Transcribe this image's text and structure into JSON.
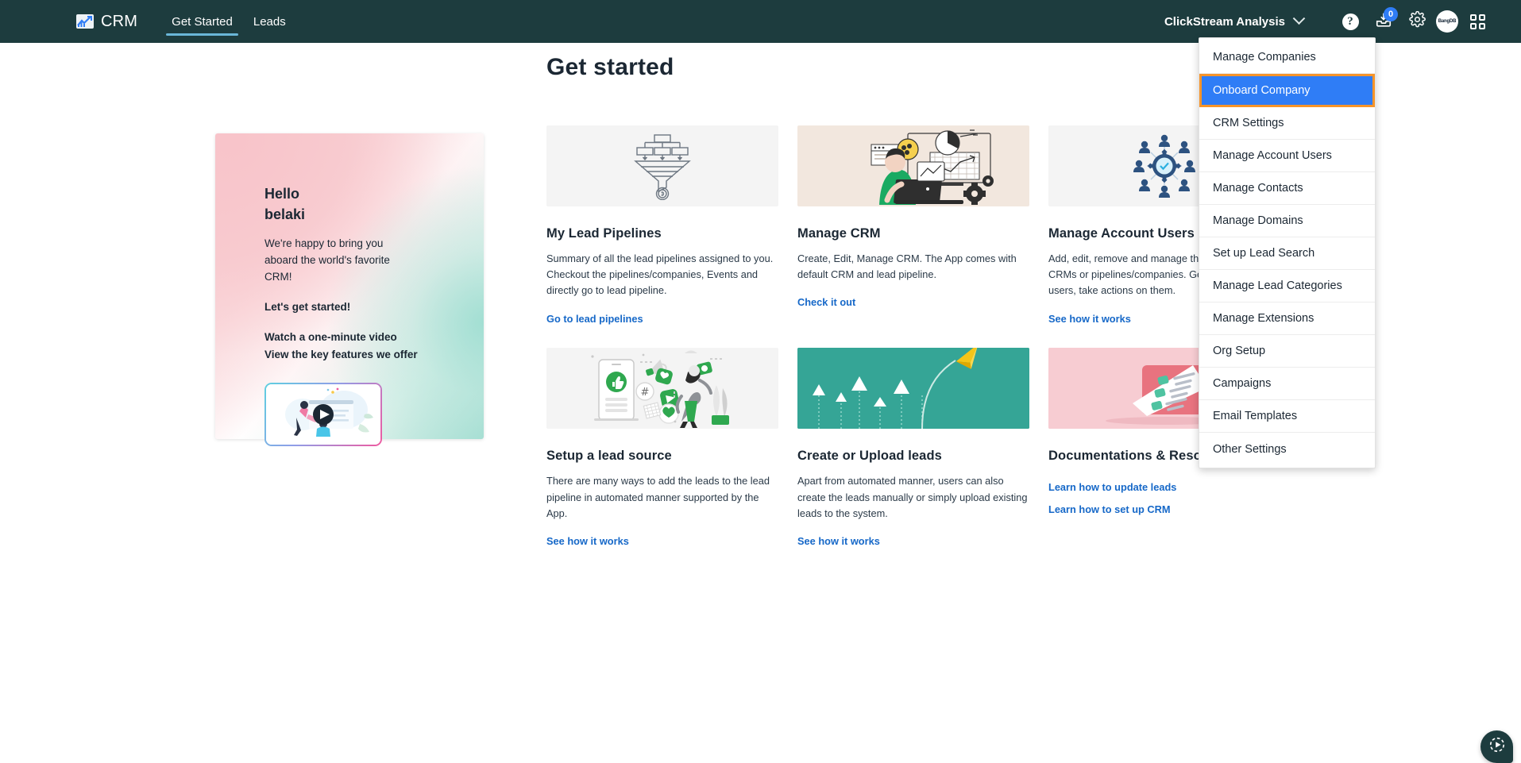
{
  "header": {
    "brand": "CRM",
    "brand_logo_icon": "chart-arrow-logo",
    "nav": [
      {
        "label": "Get Started",
        "active": true
      },
      {
        "label": "Leads",
        "active": false
      }
    ],
    "account_selector": {
      "label": "ClickStream Analysis",
      "chevron_icon": "chevron-down-icon"
    },
    "help_icon": "question-mark-icon",
    "help_glyph": "?",
    "inbox_icon": "inbox-download-icon",
    "inbox_badge": "0",
    "settings_icon": "gear-icon",
    "avatar_icon": "user-avatar",
    "avatar_text": "BangDB",
    "apps_icon": "grid-apps-icon",
    "bg_color": "#1d3c3e",
    "active_underline_color": "#6ab6d8",
    "badge_color": "#2f7df6"
  },
  "page": {
    "title": "Get started"
  },
  "hello_card": {
    "greeting_line1": "Hello",
    "greeting_line2": "belaki",
    "body": "We're happy to bring you aboard the world's favorite CRM!",
    "cta": "Let's get started!",
    "links": [
      "Watch a one-minute video",
      "View the key features we offer"
    ],
    "video_icon": "play-button-icon",
    "video_alt": "one-minute intro video thumbnail"
  },
  "cards": [
    {
      "title": "My Lead Pipelines",
      "desc": "Summary of all the lead pipelines assigned to you. Checkout the pipelines/companies, Events and directly go to lead pipeline.",
      "links": [
        "Go to lead pipelines"
      ],
      "image_icon": "funnel-pipeline-illustration",
      "image_bg": "#f4f4f4"
    },
    {
      "title": "Manage CRM",
      "desc": "Create, Edit, Manage CRM. The App comes with default CRM and lead pipeline.",
      "links": [
        "Check it out"
      ],
      "image_icon": "person-at-desk-analytics-illustration",
      "image_bg": "#f2e7de"
    },
    {
      "title": "Manage Account Users",
      "desc": "Add, edit, remove and manage the users for the CRMs or pipelines/companies. Get the list of all users, take actions on them.",
      "links": [
        "See how it works"
      ],
      "image_icon": "users-network-gear-illustration",
      "image_bg": "#f4f4f4"
    },
    {
      "title": "Setup a lead source",
      "desc": "There are many ways to add the leads to the lead pipeline in automated manner supported by the App.",
      "links": [
        "See how it works"
      ],
      "image_icon": "social-media-marketing-illustration",
      "image_bg": "#f4f4f4"
    },
    {
      "title": "Create or Upload leads",
      "desc": "Apart from automated manner, users can also create the leads manually or simply upload existing leads to the system.",
      "links": [
        "See how it works"
      ],
      "image_icon": "paper-plane-growth-arrows-illustration",
      "image_bg": "#35a596"
    },
    {
      "title": "Documentations & Resources",
      "desc": "",
      "links": [
        "Learn how to update leads",
        "Learn how to set up CRM"
      ],
      "image_icon": "checklist-pencil-illustration",
      "image_bg": "#f7ccd2"
    }
  ],
  "dropdown": {
    "items": [
      {
        "label": "Manage Companies",
        "selected": false
      },
      {
        "label": "Onboard Company",
        "selected": true
      },
      {
        "label": "CRM Settings",
        "selected": false
      },
      {
        "label": "Manage Account Users",
        "selected": false
      },
      {
        "label": "Manage Contacts",
        "selected": false
      },
      {
        "label": "Manage Domains",
        "selected": false
      },
      {
        "label": "Set up Lead Search",
        "selected": false
      },
      {
        "label": "Manage Lead Categories",
        "selected": false
      },
      {
        "label": "Manage Extensions",
        "selected": false
      },
      {
        "label": "Org Setup",
        "selected": false
      },
      {
        "label": "Campaigns",
        "selected": false
      },
      {
        "label": "Email Templates",
        "selected": false
      },
      {
        "label": "Other Settings",
        "selected": false
      }
    ],
    "selected_bg": "#2f7df6",
    "highlight_border": "#f79429"
  },
  "fab": {
    "icon": "play-circle-dashed-icon",
    "label": "Help video launcher"
  }
}
